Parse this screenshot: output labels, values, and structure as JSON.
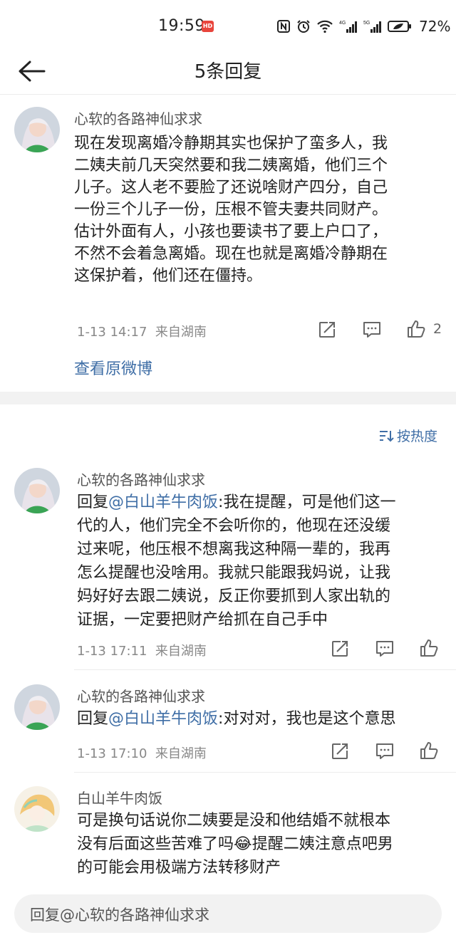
{
  "status_bar": {
    "time": "19:59",
    "hd_badge": "HD",
    "battery_percent": "72%"
  },
  "header": {
    "title": "5条回复"
  },
  "main_comment": {
    "user": "心软的各路神仙求求",
    "text": "现在发现离婚冷静期其实也保护了蛮多人，我二姨夫前几天突然要和我二姨离婚，他们三个儿子。这人老不要脸了还说啥财产四分，自己一份三个儿子一份，压根不管夫妻共同财产。估计外面有人，小孩也要读书了要上户口了，不然不会着急离婚。现在也就是离婚冷静期在这保护着，他们还在僵持。",
    "lines": [
      "现在发现离婚冷静期其实也保护了蛮多人，我",
      "二姨夫前几天突然要和我二姨离婚，他们三个",
      "儿子。这人老不要脸了还说啥财产四分，自己",
      "一份三个儿子一份，压根不管夫妻共同财产。",
      "估计外面有人，小孩也要读书了要上户口了，",
      "不然不会着急离婚。现在也就是离婚冷静期在",
      "这保护着，他们还在僵持。"
    ],
    "time": "1-13 14:17",
    "location": "来自湖南",
    "like_count": "2"
  },
  "view_original_link": "查看原微博",
  "sort_label": "按热度",
  "replies": [
    {
      "user": "心软的各路神仙求求",
      "reply_prefix": "回复",
      "mention": "@白山羊牛肉饭",
      "lines": [
        ":我在提醒，可是他们这一",
        "代的人，他们完全不会听你的，他现在还没缓",
        "过来呢，他压根不想离我这种隔一辈的，我再",
        "怎么提醒也没啥用。我就只能跟我妈说，让我",
        "妈好好去跟二姨说，反正你要抓到人家出轨的",
        "证据，一定要把财产给抓在自己手中"
      ],
      "time": "1-13 17:11",
      "location": "来自湖南"
    },
    {
      "user": "心软的各路神仙求求",
      "reply_prefix": "回复",
      "mention": "@白山羊牛肉饭",
      "lines": [
        ":对对对，我也是这个意思"
      ],
      "time": "1-13 17:10",
      "location": "来自湖南"
    },
    {
      "user": "白山羊牛肉饭",
      "lines": [
        "可是换句话说你二姨要是没和他结婚不就根本",
        "没有后面这些苦难了吗",
        "提醒二姨注意点吧男",
        "的可能会用极端方法转移财产"
      ],
      "emoji": "😂"
    }
  ],
  "reply_input": {
    "placeholder": "回复@心软的各路神仙求求"
  },
  "colors": {
    "link": "#3f6ea6",
    "meta": "#888888",
    "divider": "#ececec",
    "section_gap": "#f2f2f2"
  },
  "icons": [
    "back-arrow-icon",
    "share-icon",
    "comment-icon",
    "like-icon",
    "sort-icon"
  ]
}
